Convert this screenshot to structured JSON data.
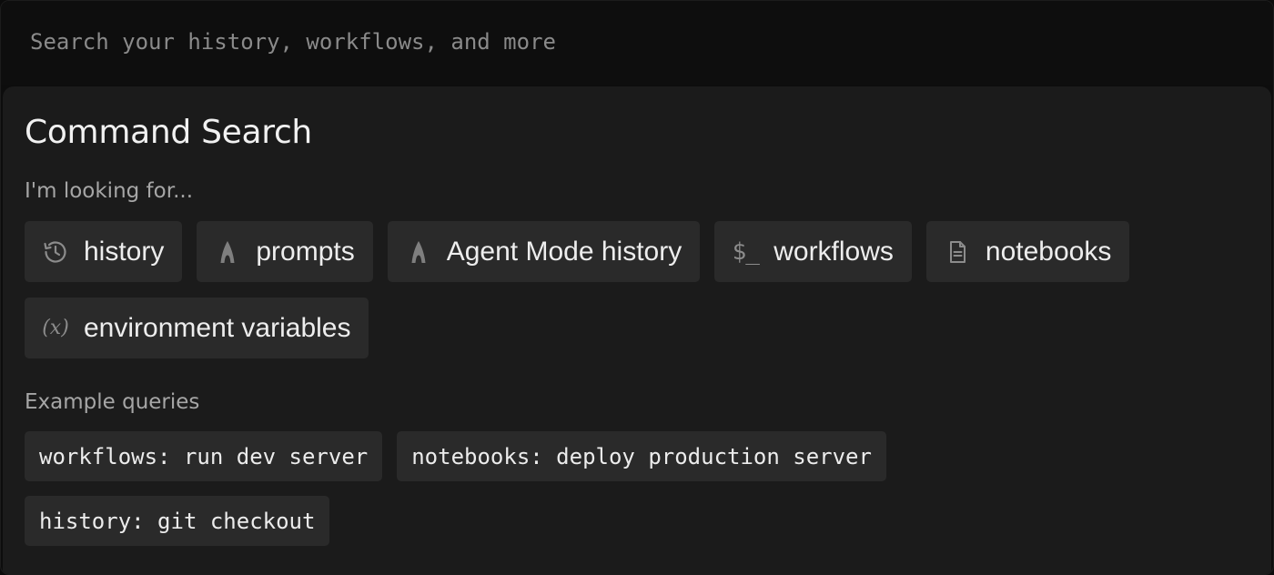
{
  "search": {
    "placeholder": "Search your history, workflows, and more"
  },
  "panel": {
    "title": "Command Search",
    "looking_for_label": "I'm looking for...",
    "filters": [
      {
        "label": "history",
        "icon": "clock-history-icon"
      },
      {
        "label": "prompts",
        "icon": "agent-a-icon"
      },
      {
        "label": "Agent Mode history",
        "icon": "agent-a-icon"
      },
      {
        "label": "workflows",
        "icon": "terminal-dollar-icon",
        "icon_text": "$_"
      },
      {
        "label": "notebooks",
        "icon": "document-icon"
      },
      {
        "label": "environment variables",
        "icon": "variable-x-icon",
        "icon_text": "(x)"
      }
    ],
    "examples_label": "Example queries",
    "examples": [
      "workflows: run dev server",
      "notebooks: deploy production server",
      "history: git checkout"
    ]
  },
  "colors": {
    "background": "#0d0d0d",
    "panel": "#1b1b1b",
    "chip": "#2a2a2a",
    "text": "#ececec",
    "muted": "#a6a6a6"
  }
}
